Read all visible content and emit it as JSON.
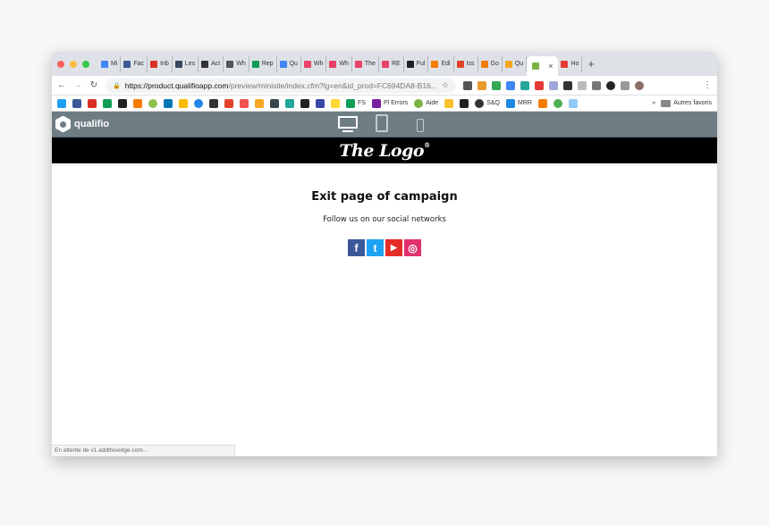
{
  "colors": {
    "close": "#fc615d",
    "minimize": "#fdbc40",
    "maximize": "#34c84a",
    "app_bar": "#6e7d84",
    "facebook": "#3b5998",
    "twitter": "#1da1f2",
    "youtube": "#e52d27",
    "instagram": "#e1306c"
  },
  "tabs": [
    {
      "title": "Mi",
      "icon": "docs-icon",
      "color": "#4285f4"
    },
    {
      "title": "Fac",
      "icon": "facebook-icon",
      "color": "#3b5998"
    },
    {
      "title": "Inb",
      "icon": "gmail-icon",
      "color": "#d93025"
    },
    {
      "title": "Les",
      "icon": "app-icon",
      "color": "#34495e"
    },
    {
      "title": "Act",
      "icon": "producthunt-icon",
      "color": "#333333"
    },
    {
      "title": "Wh",
      "icon": "app-icon",
      "color": "#555555"
    },
    {
      "title": "Rep",
      "icon": "sheets-icon",
      "color": "#0f9d58"
    },
    {
      "title": "Qu",
      "icon": "docs-icon",
      "color": "#4285f4"
    },
    {
      "title": "Wh",
      "icon": "app-icon",
      "color": "#e8426a"
    },
    {
      "title": "Wh",
      "icon": "app-icon",
      "color": "#e8426a"
    },
    {
      "title": "The",
      "icon": "app-icon",
      "color": "#e8426a"
    },
    {
      "title": "RE",
      "icon": "app-icon",
      "color": "#e8426a"
    },
    {
      "title": "Ful",
      "icon": "app-icon",
      "color": "#222222"
    },
    {
      "title": "Edi",
      "icon": "gear-icon",
      "color": "#f57c00"
    },
    {
      "title": "Iss",
      "icon": "gitlab-icon",
      "color": "#e24329"
    },
    {
      "title": "Go",
      "icon": "gear-icon",
      "color": "#f57c00"
    },
    {
      "title": "Qu",
      "icon": "app-icon",
      "color": "#f5a623"
    }
  ],
  "active_tab": {
    "title": "",
    "icon": "qualifio-icon",
    "color": "#7cb342",
    "close": "×"
  },
  "next_tab": {
    "title": "Ho",
    "icon": "user-icon",
    "color": "#e53935"
  },
  "new_tab": "+",
  "nav": {
    "back": "←",
    "forward": "→",
    "reload": "↻"
  },
  "url": {
    "host": "https://product.qualifioapp.com",
    "path": "/preview/minisite/index.cfm?lg=en&id_prod=FC694DA8-B16..."
  },
  "star": "☆",
  "menu": "⋮",
  "bookmarks_labels": {
    "pl_errors": "Pl Errors",
    "aide": "Aide",
    "fs": "FS",
    "sq": "S&Q",
    "mrr": "MRR",
    "more": "»",
    "autres": "Autres favoris"
  },
  "brand": {
    "name": "qualifio"
  },
  "site_logo": {
    "text": "The Logo",
    "mark": "®"
  },
  "page": {
    "title": "Exit page of campaign",
    "subtitle": "Follow us on our social networks"
  },
  "social_labels": {
    "facebook": "f",
    "twitter": "t",
    "youtube": "▶",
    "instagram": "◎"
  },
  "status_bar": "En attente de v1.addthisedge.com..."
}
